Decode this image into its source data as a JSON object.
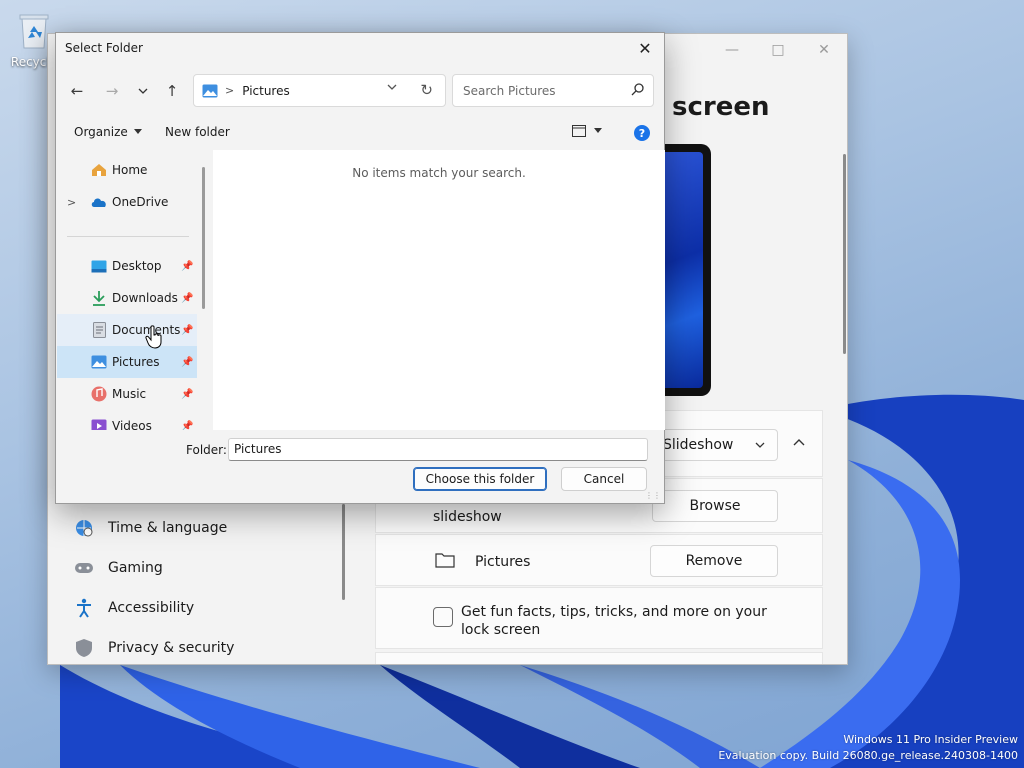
{
  "desktop": {
    "recycle_label": "Recycle",
    "watermark_line1": "Windows 11 Pro Insider Preview",
    "watermark_line2": "Evaluation copy. Build 26080.ge_release.240308-1400"
  },
  "settings": {
    "heading": "screen",
    "slideshow_select": "Slideshow",
    "slideshow_caption": "slideshow",
    "browse_label": "Browse",
    "folder_name": "Pictures",
    "remove_label": "Remove",
    "fun_facts_label": "Get fun facts, tips, tricks, and more on your lock screen",
    "fun_facts_checked": false,
    "nav": [
      {
        "label": "Time & language",
        "icon": "globe-clock-icon"
      },
      {
        "label": "Gaming",
        "icon": "gamepad-icon"
      },
      {
        "label": "Accessibility",
        "icon": "accessibility-icon"
      },
      {
        "label": "Privacy & security",
        "icon": "shield-icon"
      }
    ]
  },
  "dialog": {
    "title": "Select Folder",
    "address": {
      "location": "Pictures"
    },
    "search_placeholder": "Search Pictures",
    "organize_label": "Organize",
    "new_folder_label": "New folder",
    "help_glyph": "?",
    "empty_message": "No items match your search.",
    "tree": [
      {
        "label": "Home",
        "icon": "home-icon"
      },
      {
        "label": "OneDrive",
        "icon": "cloud-icon"
      },
      {
        "label": "Desktop",
        "icon": "desktop-icon"
      },
      {
        "label": "Downloads",
        "icon": "download-icon"
      },
      {
        "label": "Documents",
        "icon": "document-icon"
      },
      {
        "label": "Pictures",
        "icon": "pictures-icon"
      },
      {
        "label": "Music",
        "icon": "music-icon"
      },
      {
        "label": "Videos",
        "icon": "video-icon"
      }
    ],
    "folder_label": "Folder:",
    "folder_value": "Pictures",
    "choose_label": "Choose this folder",
    "cancel_label": "Cancel"
  }
}
